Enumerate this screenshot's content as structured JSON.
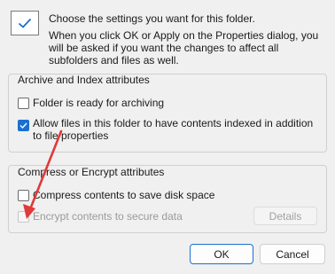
{
  "header": {
    "title": "Choose the settings you want for this folder.",
    "description": "When you click OK or Apply on the Properties dialog, you will be asked if you want the changes to affect all subfolders and files as well."
  },
  "archive_group": {
    "label": "Archive and Index attributes",
    "items": [
      {
        "label": "Folder is ready for archiving",
        "checked": false
      },
      {
        "label": "Allow files in this folder to have contents indexed in addition to file properties",
        "checked": true
      }
    ]
  },
  "compress_group": {
    "label": "Compress or Encrypt attributes",
    "items": [
      {
        "label": "Compress contents to save disk space",
        "checked": false
      },
      {
        "label": "Encrypt contents to secure data",
        "checked": false,
        "disabled": true
      }
    ],
    "details_label": "Details"
  },
  "footer": {
    "ok_label": "OK",
    "cancel_label": "Cancel"
  },
  "colors": {
    "accent": "#1a6fd2",
    "arrow": "#e03a3a"
  },
  "icons": {
    "header_check": "checkmark-icon",
    "annotation": "red-arrow-annotation"
  }
}
